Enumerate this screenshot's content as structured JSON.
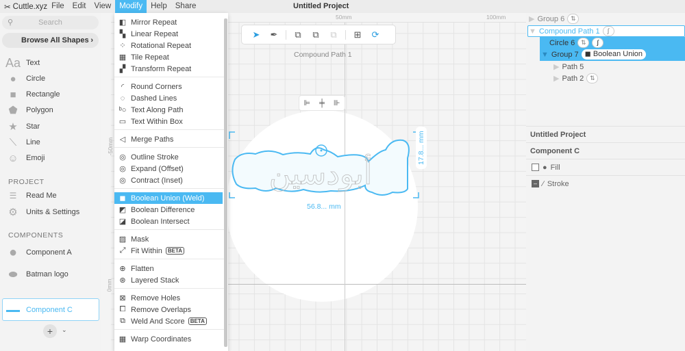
{
  "app": {
    "name": "Cuttle.xyz",
    "project_title": "Untitled Project"
  },
  "menubar": [
    "File",
    "Edit",
    "View",
    "Modify",
    "Help",
    "Share"
  ],
  "sidebar": {
    "search_placeholder": "Search",
    "browse": "Browse All Shapes",
    "shapes": [
      {
        "icon": "text-icon",
        "label": "Text"
      },
      {
        "icon": "circle-icon",
        "label": "Circle"
      },
      {
        "icon": "rectangle-icon",
        "label": "Rectangle"
      },
      {
        "icon": "polygon-icon",
        "label": "Polygon"
      },
      {
        "icon": "star-icon",
        "label": "Star"
      },
      {
        "icon": "line-icon",
        "label": "Line"
      },
      {
        "icon": "emoji-icon",
        "label": "Emoji"
      }
    ],
    "project_heading": "PROJECT",
    "project_items": [
      {
        "icon": "document-icon",
        "label": "Read Me"
      },
      {
        "icon": "gear-icon",
        "label": "Units & Settings"
      }
    ],
    "components_heading": "COMPONENTS",
    "components": [
      {
        "label": "Component A"
      },
      {
        "label": "Batman logo"
      },
      {
        "label": "Component C",
        "selected": true
      }
    ]
  },
  "modify_menu": {
    "groups": [
      [
        {
          "icon": "mirror-repeat-icon",
          "label": "Mirror Repeat"
        },
        {
          "icon": "linear-repeat-icon",
          "label": "Linear Repeat"
        },
        {
          "icon": "rotational-repeat-icon",
          "label": "Rotational Repeat"
        },
        {
          "icon": "tile-repeat-icon",
          "label": "Tile Repeat"
        },
        {
          "icon": "transform-repeat-icon",
          "label": "Transform Repeat"
        }
      ],
      [
        {
          "icon": "round-corners-icon",
          "label": "Round Corners"
        },
        {
          "icon": "dashed-lines-icon",
          "label": "Dashed Lines"
        },
        {
          "icon": "text-along-path-icon",
          "label": "Text Along Path"
        },
        {
          "icon": "text-within-box-icon",
          "label": "Text Within Box"
        }
      ],
      [
        {
          "icon": "merge-paths-icon",
          "label": "Merge Paths"
        }
      ],
      [
        {
          "icon": "outline-stroke-icon",
          "label": "Outline Stroke"
        },
        {
          "icon": "expand-icon",
          "label": "Expand (Offset)"
        },
        {
          "icon": "contract-icon",
          "label": "Contract (Inset)"
        }
      ],
      [
        {
          "icon": "boolean-union-icon",
          "label": "Boolean Union (Weld)",
          "highlighted": true
        },
        {
          "icon": "boolean-difference-icon",
          "label": "Boolean Difference"
        },
        {
          "icon": "boolean-intersect-icon",
          "label": "Boolean Intersect"
        }
      ],
      [
        {
          "icon": "mask-icon",
          "label": "Mask"
        },
        {
          "icon": "fit-within-icon",
          "label": "Fit Within",
          "badge": "BETA"
        }
      ],
      [
        {
          "icon": "flatten-icon",
          "label": "Flatten"
        },
        {
          "icon": "layered-stack-icon",
          "label": "Layered Stack"
        }
      ],
      [
        {
          "icon": "remove-holes-icon",
          "label": "Remove Holes"
        },
        {
          "icon": "remove-overlaps-icon",
          "label": "Remove Overlaps"
        },
        {
          "icon": "weld-and-score-icon",
          "label": "Weld And Score",
          "badge": "BETA"
        }
      ],
      [
        {
          "icon": "warp-coordinates-icon",
          "label": "Warp Coordinates"
        }
      ]
    ]
  },
  "canvas": {
    "ruler_top": [
      "50mm",
      "100mm"
    ],
    "ruler_left": [
      "-50mm",
      "0mm"
    ],
    "selection_label": "Compound Path 1",
    "width_dim": "56.8... mm",
    "height_dim": "17.8... mm",
    "artwork_text": "أبودسين",
    "accent": "#4ab9f2"
  },
  "layers": {
    "items": [
      {
        "label": "Group 6",
        "badge": "transform-icon"
      },
      {
        "label": "Compound Path 1",
        "badge": "stroke-icon",
        "selected": true
      },
      {
        "label": "Circle 6",
        "badges": [
          "transform-icon",
          "stroke-icon"
        ]
      },
      {
        "label": "Group 7",
        "pill": "Boolean Union"
      },
      {
        "label": "Path 5"
      },
      {
        "label": "Path 2",
        "badge": "transform-icon"
      }
    ]
  },
  "properties": {
    "project": "Untitled Project",
    "component": "Component C",
    "fill": "Fill",
    "stroke": "Stroke",
    "fill_checked": false
  }
}
